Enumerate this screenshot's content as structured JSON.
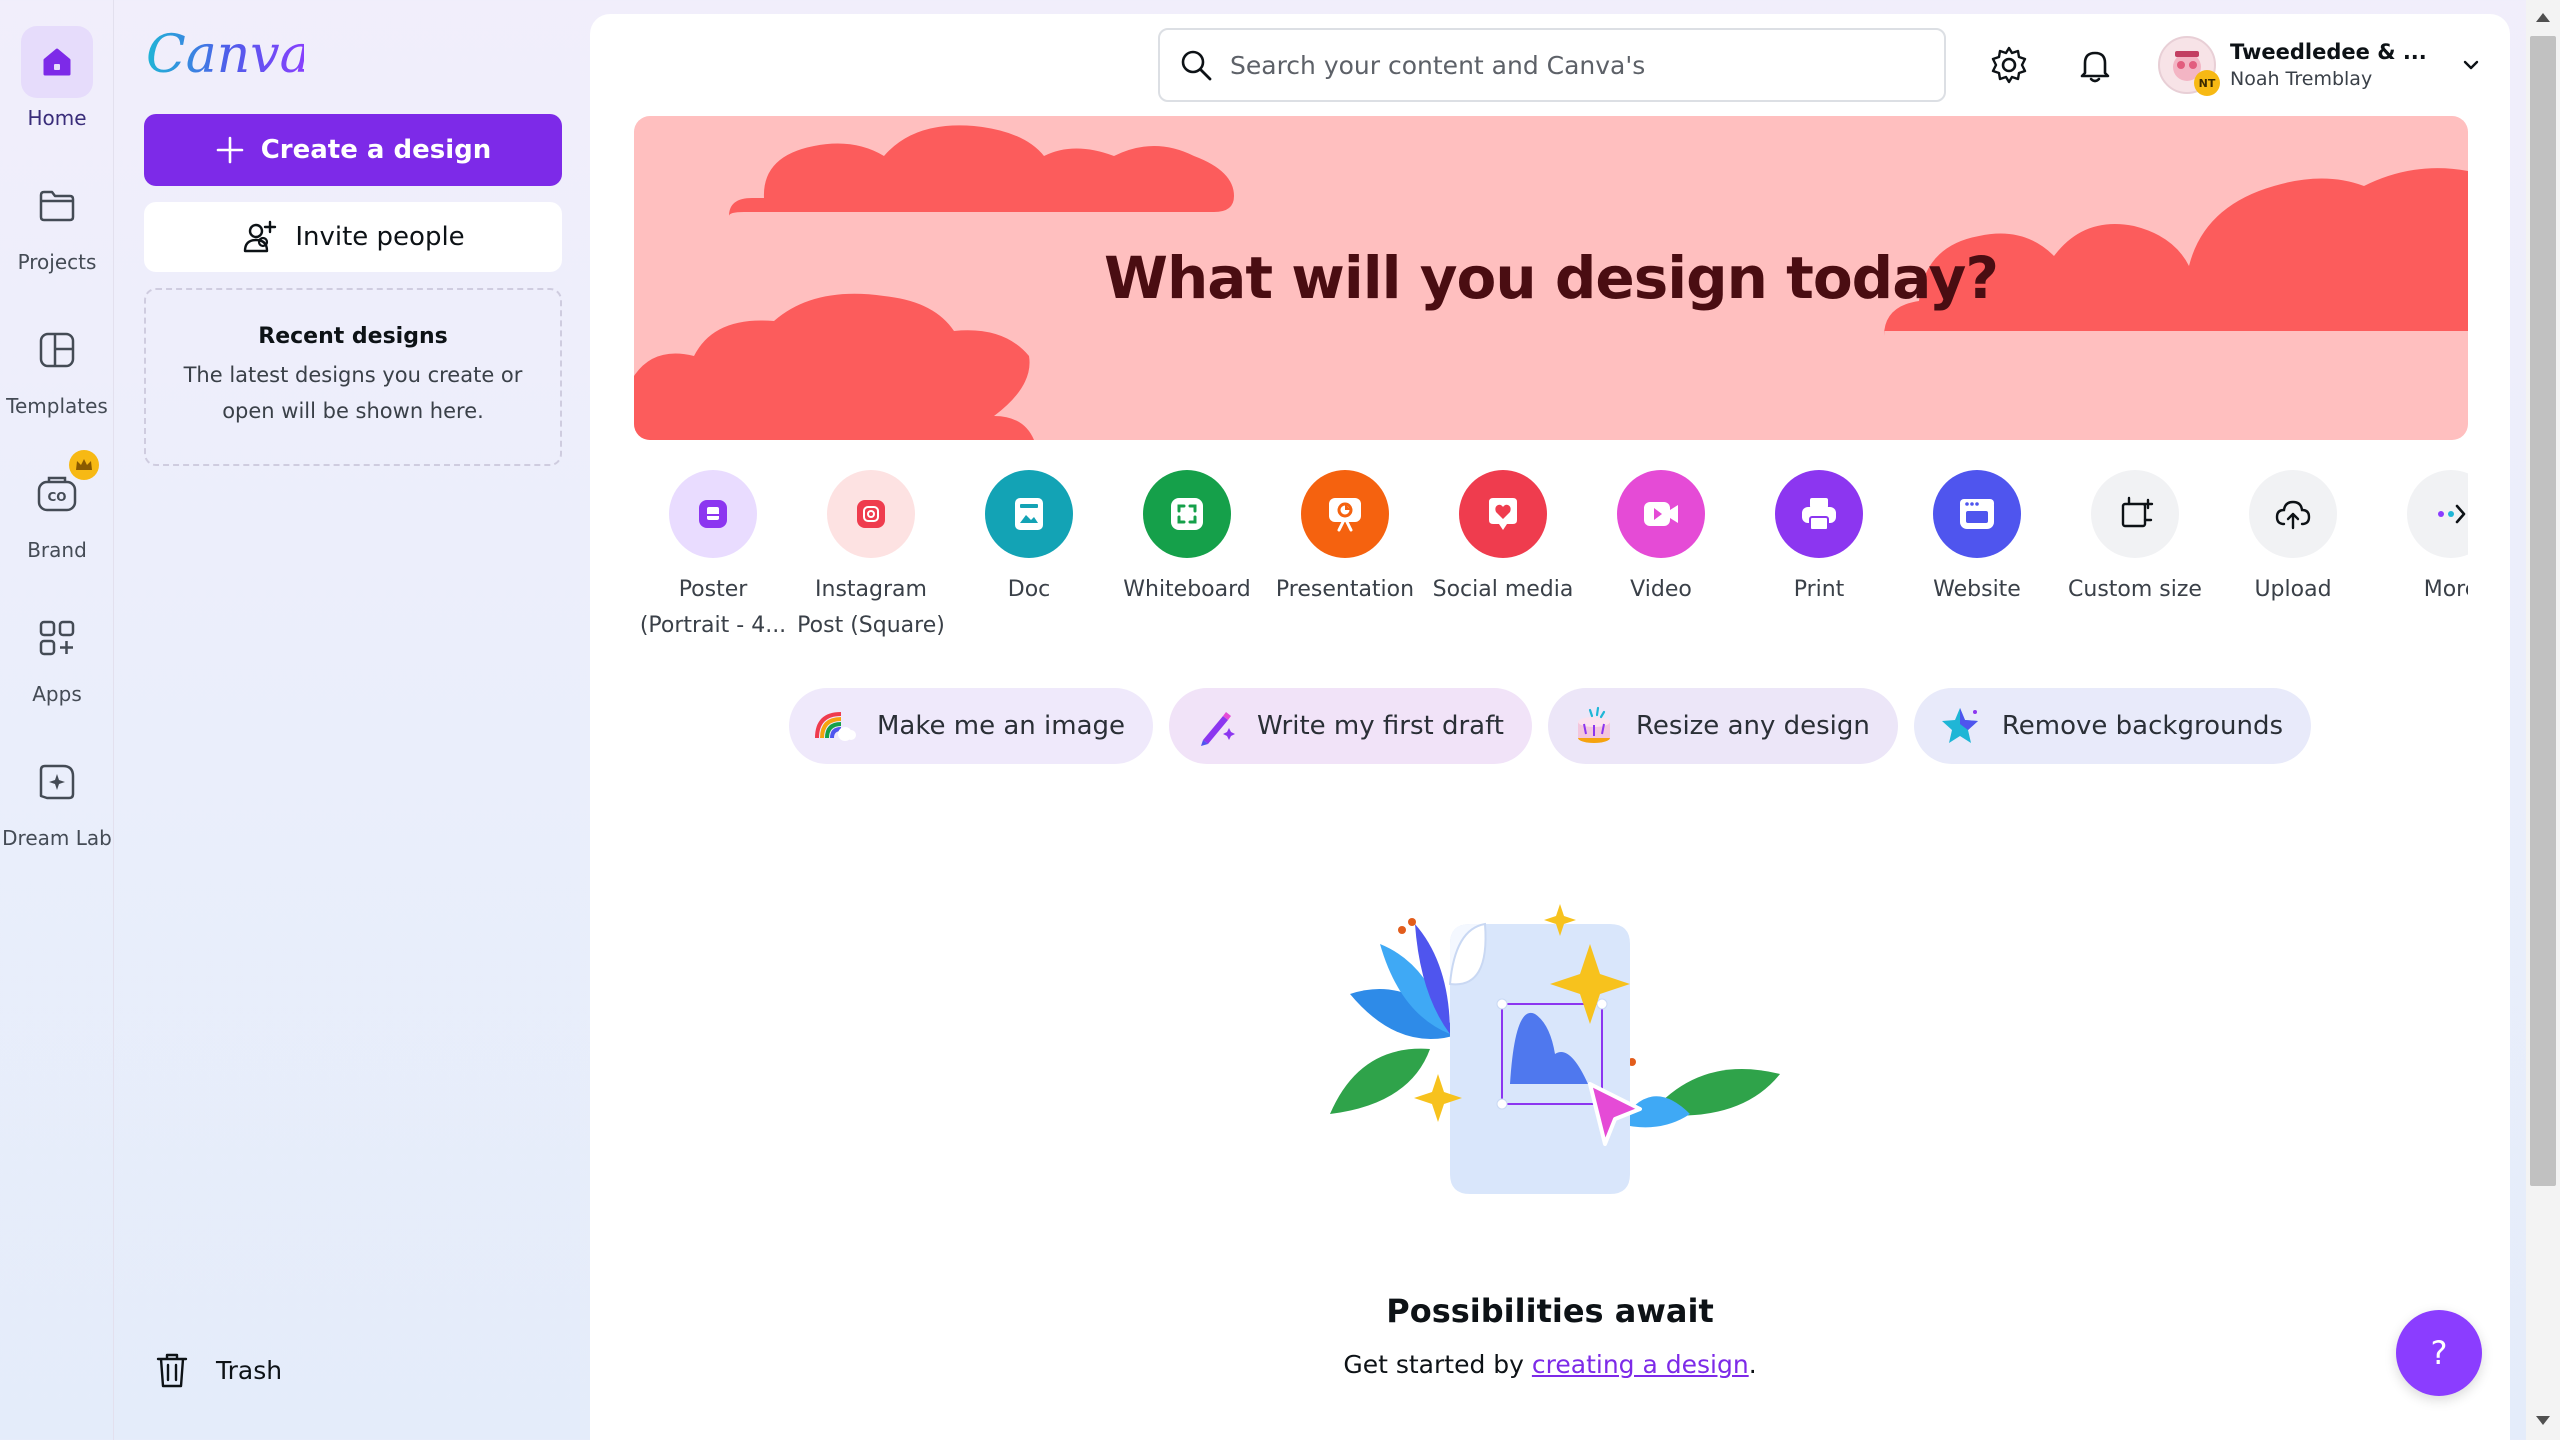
{
  "rail": {
    "items": [
      {
        "label": "Home",
        "icon": "home-icon"
      },
      {
        "label": "Projects",
        "icon": "folder-icon"
      },
      {
        "label": "Templates",
        "icon": "templates-icon"
      },
      {
        "label": "Brand",
        "icon": "brand-icon"
      },
      {
        "label": "Apps",
        "icon": "apps-icon"
      },
      {
        "label": "Dream Lab",
        "icon": "dream-lab-icon"
      }
    ]
  },
  "panel": {
    "logo": "Canva",
    "create_label": "Create a design",
    "invite_label": "Invite people",
    "recent_title": "Recent designs",
    "recent_desc": "The latest designs you create or open will be shown here.",
    "trash_label": "Trash"
  },
  "header": {
    "search_placeholder": "Search your content and Canva's",
    "account_name": "Tweedledee & ...",
    "account_user": "Noah Tremblay",
    "avatar_initials": "NT"
  },
  "hero": {
    "title": "What will you design today?"
  },
  "design_types": [
    {
      "label": "Poster (Portrait - 4...",
      "color": "#e9dcff",
      "icon": "poster-icon"
    },
    {
      "label": "Instagram Post (Square)",
      "color": "#fde2e2",
      "icon": "instagram-icon"
    },
    {
      "label": "Doc",
      "color": "#13a3b5",
      "icon": "doc-icon"
    },
    {
      "label": "Whiteboard",
      "color": "#15a04a",
      "icon": "whiteboard-icon"
    },
    {
      "label": "Presentation",
      "color": "#f5620f",
      "icon": "presentation-icon"
    },
    {
      "label": "Social media",
      "color": "#ef3c4e",
      "icon": "social-media-icon"
    },
    {
      "label": "Video",
      "color": "#e54bd6",
      "icon": "video-icon"
    },
    {
      "label": "Print",
      "color": "#8c36f0",
      "icon": "print-icon"
    },
    {
      "label": "Website",
      "color": "#4f55ee",
      "icon": "website-icon"
    },
    {
      "label": "Custom size",
      "color": "#f1f2f4",
      "icon": "custom-size-icon"
    },
    {
      "label": "Upload",
      "color": "#f1f2f4",
      "icon": "upload-icon"
    },
    {
      "label": "More",
      "color": "#f1f2f4",
      "icon": "more-icon"
    }
  ],
  "magic_chips": [
    {
      "label": "Make me an image",
      "bg": "#efe9fb"
    },
    {
      "label": "Write my first draft",
      "bg": "#f1e3f8"
    },
    {
      "label": "Resize any design",
      "bg": "#ece6f8"
    },
    {
      "label": "Remove backgrounds",
      "bg": "#e8eafa"
    }
  ],
  "empty_state": {
    "title": "Possibilities await",
    "prefix": "Get started by ",
    "link": "creating a design",
    "suffix": "."
  },
  "help_label": "?",
  "colors": {
    "accent": "#7d2ae8",
    "hero_bg": "#ffbfbf",
    "hero_cloud": "#fc5c5c",
    "hero_text": "#4a0d12"
  }
}
